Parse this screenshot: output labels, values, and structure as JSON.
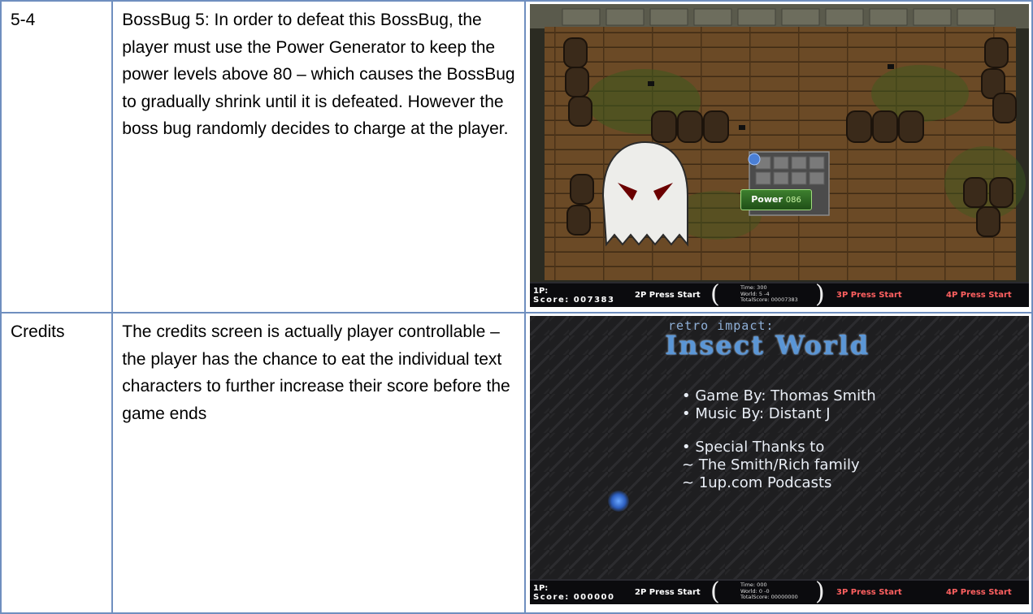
{
  "rows": [
    {
      "id": "5-4",
      "description": "BossBug 5: In order to defeat this BossBug, the player must use the Power Generator to keep the power levels above 80 – which causes the BossBug to gradually shrink until it is defeated. However the boss bug randomly decides to charge at the player.",
      "screenshot": {
        "power_label": "Power",
        "power_value": "086",
        "hud": {
          "p1_label": "1P:",
          "p1_score": "Score: 007383",
          "p2": "2P Press Start",
          "time": "Time: 300",
          "world": "World: 5 -4",
          "total": "TotalScore: 00007383",
          "p3": "3P Press Start",
          "p4": "4P Press Start"
        }
      }
    },
    {
      "id": "Credits",
      "description": "The credits screen is actually player controllable – the player has the chance to eat the individual text characters to further increase their score before the game ends",
      "screenshot": {
        "title_small": "retro impact:",
        "title": "Insect World",
        "lines": [
          "• Game By: Thomas Smith",
          "• Music By: Distant J"
        ],
        "lines2": [
          "• Special Thanks to",
          "~ The Smith/Rich family",
          "~ 1up.com Podcasts"
        ],
        "hud": {
          "p1_label": "1P:",
          "p1_score": "Score: 000000",
          "p2": "2P Press Start",
          "time": "Time: 000",
          "world": "World: 0 -0",
          "total": "TotalScore: 00000000",
          "p3": "3P Press Start",
          "p4": "4P Press Start"
        }
      }
    }
  ]
}
